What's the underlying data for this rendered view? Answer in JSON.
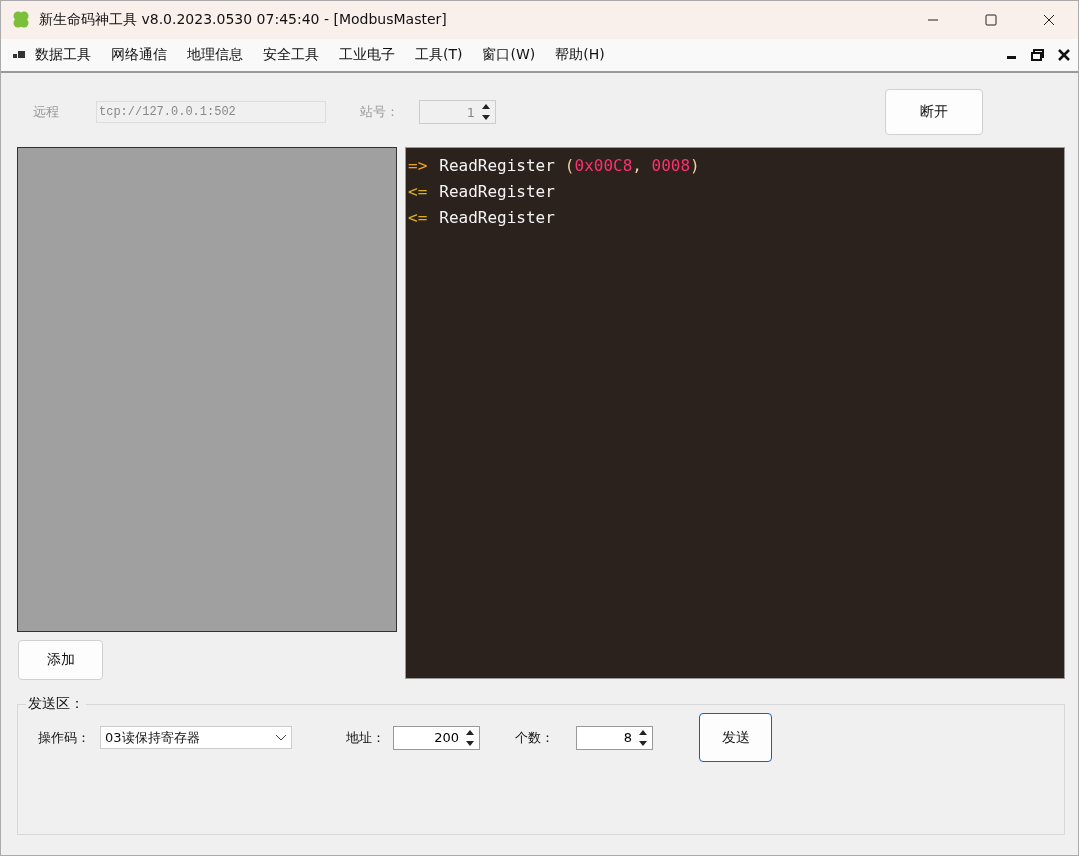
{
  "window": {
    "title": "新生命码神工具 v8.0.2023.0530 07:45:40 - [ModbusMaster]"
  },
  "menu": [
    "数据工具",
    "网络通信",
    "地理信息",
    "安全工具",
    "工业电子",
    "工具(T)",
    "窗口(W)",
    "帮助(H)"
  ],
  "connection": {
    "disabled": true,
    "remote_label": "远程",
    "remote_value": "tcp://127.0.0.1:502",
    "station_label": "站号：",
    "station_value": "1",
    "button": "断开"
  },
  "add_button": "添加",
  "log": [
    {
      "kind": "send",
      "arrow": "=>",
      "command": "ReadRegister",
      "parts": [
        {
          "kind": "punct",
          "text": "("
        },
        {
          "kind": "number",
          "text": "0x00C8"
        },
        {
          "kind": "punct",
          "text": ", "
        },
        {
          "kind": "number",
          "text": "0008"
        },
        {
          "kind": "punct",
          "text": ")"
        }
      ]
    },
    {
      "kind": "receive",
      "arrow": "<=",
      "command": "ReadRegister"
    },
    {
      "kind": "receive",
      "arrow": "<=",
      "command": "ReadRegister"
    }
  ],
  "send_area": {
    "legend": "发送区：",
    "opcode_label": "操作码：",
    "opcode_value": "03读保持寄存器",
    "address_label": "地址：",
    "address_value": "200",
    "count_label": "个数：",
    "count_value": "8",
    "send_button": "发送"
  }
}
